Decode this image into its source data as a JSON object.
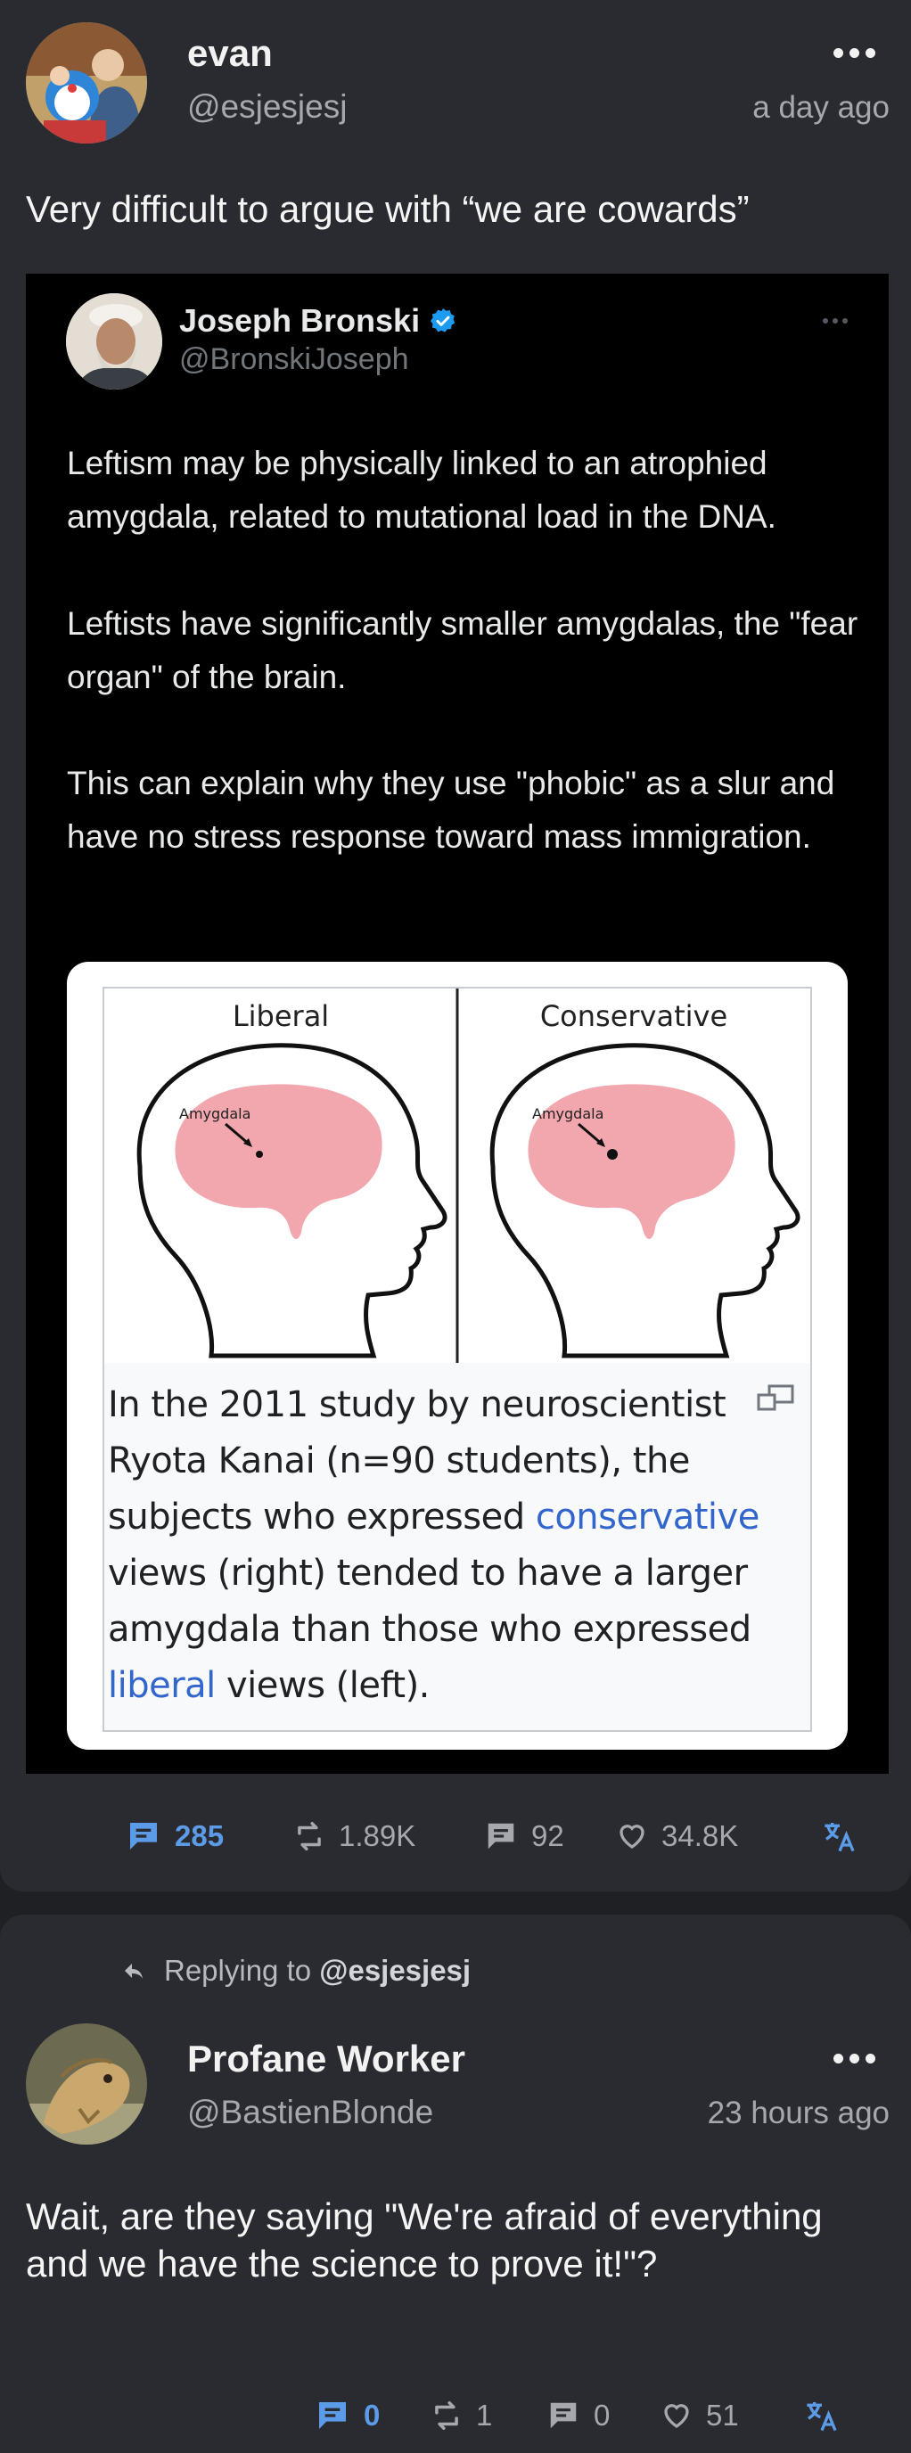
{
  "post1": {
    "author_name": "evan",
    "author_handle": "@esjesjesj",
    "time": "a day ago",
    "text": "Very difficult to argue with “we are cowards”",
    "quote": {
      "name": "Joseph Bronski",
      "handle": "@BronskiJoseph",
      "paragraphs": [
        "Leftism may be physically linked to an atrophied amygdala, related to mutational load in the DNA.",
        "Leftists have significantly smaller amygdalas, the \"fear organ\" of the brain.",
        "This can explain why they use \"phobic\" as a slur and have no stress response toward mass immigration."
      ],
      "image": {
        "left_label": "Liberal",
        "right_label": "Conservative",
        "brain_label": "Amygdala",
        "caption_1": "In the 2011 study by neuroscientist Ryota Kanai (n=90 students), the subjects who expressed ",
        "caption_link_1": "conservative",
        "caption_2": " views (right) tended to have a larger amygdala than those who expressed ",
        "caption_link_2": "liberal",
        "caption_3": " views (left)."
      }
    },
    "stats": {
      "replies": "285",
      "boosts": "1.89K",
      "quotes": "92",
      "likes": "34.8K"
    }
  },
  "post2": {
    "replying_prefix": "Replying to",
    "replying_handle": "@esjesjesj",
    "author_name": "Profane Worker",
    "author_handle": "@BastienBlonde",
    "time": "23 hours ago",
    "text": "Wait, are they saying \"We're afraid of everything and we have the science to prove it!\"?",
    "stats": {
      "replies": "0",
      "boosts": "1",
      "quotes": "0",
      "likes": "51"
    }
  },
  "colors": {
    "background": "#1f2024",
    "card": "#2a2b30",
    "accent": "#5b9be8",
    "verified": "#1d9bf0",
    "link": "#3366cc"
  }
}
